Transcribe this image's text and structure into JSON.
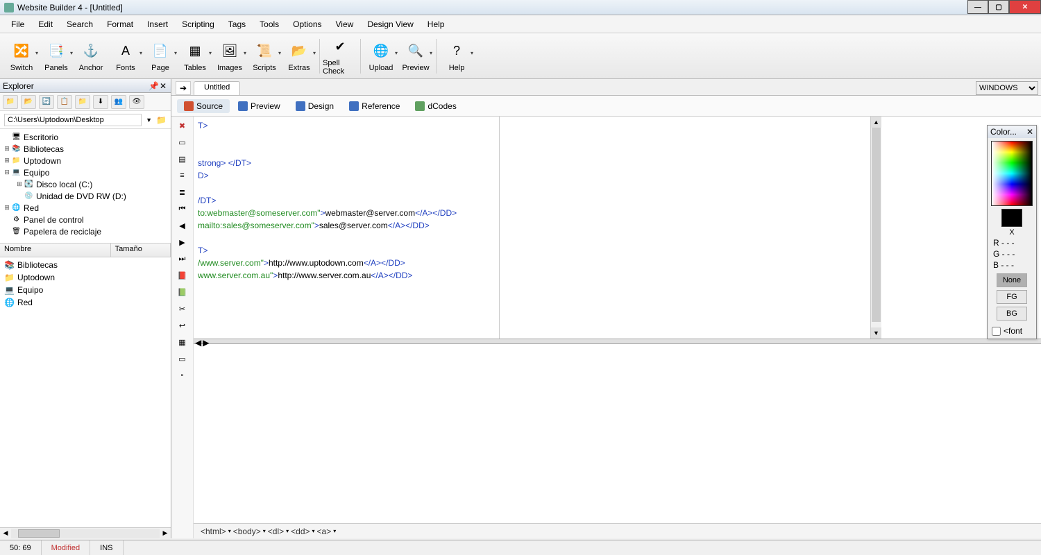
{
  "window": {
    "title": "Website Builder 4 - [Untitled]"
  },
  "menu": [
    "File",
    "Edit",
    "Search",
    "Format",
    "Insert",
    "Scripting",
    "Tags",
    "Tools",
    "Options",
    "View",
    "Design View",
    "Help"
  ],
  "toolbar": [
    {
      "label": "Switch",
      "icon": "🔀",
      "dd": true
    },
    {
      "label": "Panels",
      "icon": "📑",
      "dd": true
    },
    {
      "label": "Anchor",
      "icon": "⚓",
      "dd": false
    },
    {
      "label": "Fonts",
      "icon": "A",
      "dd": true
    },
    {
      "label": "Page",
      "icon": "📄",
      "dd": true
    },
    {
      "label": "Tables",
      "icon": "▦",
      "dd": true
    },
    {
      "label": "Images",
      "icon": "🖼",
      "dd": true
    },
    {
      "label": "Scripts",
      "icon": "📜",
      "dd": true
    },
    {
      "label": "Extras",
      "icon": "📂",
      "dd": true
    },
    {
      "sep": true
    },
    {
      "label": "Spell Check",
      "icon": "✔",
      "dd": false
    },
    {
      "sep": true
    },
    {
      "label": "Upload",
      "icon": "🌐",
      "dd": true
    },
    {
      "label": "Preview",
      "icon": "🔍",
      "dd": true
    },
    {
      "sep": true
    },
    {
      "label": "Help",
      "icon": "?",
      "dd": true
    }
  ],
  "doc_tab": "Untitled",
  "encoding": "WINDOWS",
  "view_tabs": [
    {
      "label": "Source",
      "active": true,
      "color": "#d05030"
    },
    {
      "label": "Preview",
      "active": false,
      "color": "#4070c0"
    },
    {
      "label": "Design",
      "active": false,
      "color": "#4070c0"
    },
    {
      "label": "Reference",
      "active": false,
      "color": "#4070c0"
    },
    {
      "label": "dCodes",
      "active": false,
      "color": "#60a060"
    }
  ],
  "explorer": {
    "title": "Explorer",
    "path": "C:\\Users\\Uptodown\\Desktop",
    "tree": [
      {
        "indent": 0,
        "twist": "",
        "icon": "🖥",
        "label": "Escritorio"
      },
      {
        "indent": 0,
        "twist": "+",
        "icon": "📚",
        "label": "Bibliotecas"
      },
      {
        "indent": 0,
        "twist": "+",
        "icon": "📁",
        "label": "Uptodown"
      },
      {
        "indent": 0,
        "twist": "-",
        "icon": "💻",
        "label": "Equipo"
      },
      {
        "indent": 1,
        "twist": "+",
        "icon": "💽",
        "label": "Disco local (C:)"
      },
      {
        "indent": 1,
        "twist": "",
        "icon": "💿",
        "label": "Unidad de DVD RW (D:)"
      },
      {
        "indent": 0,
        "twist": "+",
        "icon": "🌐",
        "label": "Red"
      },
      {
        "indent": 0,
        "twist": "",
        "icon": "⚙",
        "label": "Panel de control"
      },
      {
        "indent": 0,
        "twist": "",
        "icon": "🗑",
        "label": "Papelera de reciclaje"
      }
    ],
    "columns": {
      "name": "Nombre",
      "size": "Tamaño"
    },
    "files": [
      {
        "icon": "📚",
        "label": "Bibliotecas"
      },
      {
        "icon": "📁",
        "label": "Uptodown"
      },
      {
        "icon": "💻",
        "label": "Equipo"
      },
      {
        "icon": "🌐",
        "label": "Red"
      }
    ]
  },
  "code_lines": [
    {
      "segs": [
        {
          "c": "bl",
          "t": "T>"
        }
      ]
    },
    {
      "segs": []
    },
    {
      "segs": []
    },
    {
      "segs": [
        {
          "c": "bl",
          "t": "strong> </DT>"
        }
      ]
    },
    {
      "segs": [
        {
          "c": "bl",
          "t": "D>"
        }
      ]
    },
    {
      "segs": []
    },
    {
      "segs": [
        {
          "c": "bl",
          "t": "/DT>"
        }
      ]
    },
    {
      "segs": [
        {
          "c": "gr",
          "t": "to:webmaster@someserver.com\""
        },
        {
          "c": "bl",
          "t": ">"
        },
        {
          "c": "bk",
          "t": "webmaster@server.com"
        },
        {
          "c": "bl",
          "t": "</A></DD>"
        }
      ]
    },
    {
      "segs": [
        {
          "c": "gr",
          "t": "mailto:sales@someserver.com\""
        },
        {
          "c": "bl",
          "t": ">"
        },
        {
          "c": "bk",
          "t": "sales@server.com"
        },
        {
          "c": "bl",
          "t": "</A></DD>"
        }
      ]
    },
    {
      "segs": []
    },
    {
      "segs": [
        {
          "c": "bl",
          "t": "T>"
        }
      ]
    },
    {
      "segs": [
        {
          "c": "gr",
          "t": "/www.server.com\""
        },
        {
          "c": "bl",
          "t": ">"
        },
        {
          "c": "bk",
          "t": "http://www.uptodown.com"
        },
        {
          "c": "bl",
          "t": "</A></DD>"
        }
      ]
    },
    {
      "segs": [
        {
          "c": "gr",
          "t": "www.server.com.au\""
        },
        {
          "c": "bl",
          "t": ">"
        },
        {
          "c": "bk",
          "t": "http://www.server.com.au"
        },
        {
          "c": "bl",
          "t": "</A></DD>"
        }
      ]
    }
  ],
  "breadcrumb": [
    "<html>",
    "<body>",
    "<dl>",
    "<dd>",
    "<a>"
  ],
  "color_panel": {
    "title": "Color...",
    "x_label": "X",
    "rgb": {
      "r": "R - - -",
      "g": "G - - -",
      "b": "B - - -"
    },
    "none": "None",
    "fg": "FG",
    "bg": "BG",
    "font_label": "<font"
  },
  "status": {
    "pos": "50: 69",
    "modified": "Modified",
    "ins": "INS"
  }
}
